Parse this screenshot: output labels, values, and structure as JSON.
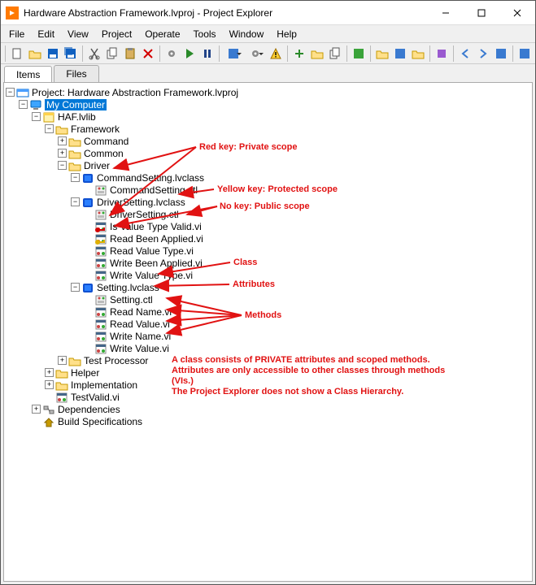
{
  "domain": "Computer-Use",
  "window": {
    "title": "Hardware Abstraction Framework.lvproj - Project Explorer"
  },
  "menu": {
    "file": "File",
    "edit": "Edit",
    "view": "View",
    "project": "Project",
    "operate": "Operate",
    "tools": "Tools",
    "window": "Window",
    "help": "Help"
  },
  "tabs": {
    "items": "Items",
    "files": "Files"
  },
  "tree": {
    "project": "Project: Hardware Abstraction Framework.lvproj",
    "my_computer": "My Computer",
    "haf": "HAF.lvlib",
    "framework": "Framework",
    "command": "Command",
    "common": "Common",
    "driver": "Driver",
    "commandsetting_class": "CommandSetting.lvclass",
    "commandsetting_ctl": "CommandSetting.ctl",
    "driversetting_class": "DriverSetting.lvclass",
    "driversetting_ctl": "DriverSetting.ctl",
    "is_value_type_valid": "Is Value Type Valid.vi",
    "read_been_applied": "Read Been Applied.vi",
    "read_value_type": "Read Value Type.vi",
    "write_been_applied": "Write Been Applied.vi",
    "write_value_type": "Write Value Type.vi",
    "setting_class": "Setting.lvclass",
    "setting_ctl": "Setting.ctl",
    "read_name": "Read Name.vi",
    "read_value": "Read Value.vi",
    "write_name": "Write Name.vi",
    "write_value": "Write Value.vi",
    "test_processor": "Test Processor",
    "helper": "Helper",
    "implementation": "Implementation",
    "testvalid": "TestValid.vi",
    "dependencies": "Dependencies",
    "build_specs": "Build Specifications"
  },
  "twisty": {
    "minus": "−",
    "plus": "+"
  },
  "annotations": {
    "red_key": "Red key: Private scope",
    "yellow_key": "Yellow key: Protected scope",
    "no_key": "No key: Public scope",
    "class": "Class",
    "attributes": "Attributes",
    "methods": "Methods",
    "note_line1": "A class consists of PRIVATE attributes and scoped methods.",
    "note_line2": "Attributes are only accessible to other classes through methods",
    "note_line3": "(VIs.)",
    "note_line4": "The Project Explorer does not show a Class Hierarchy."
  }
}
